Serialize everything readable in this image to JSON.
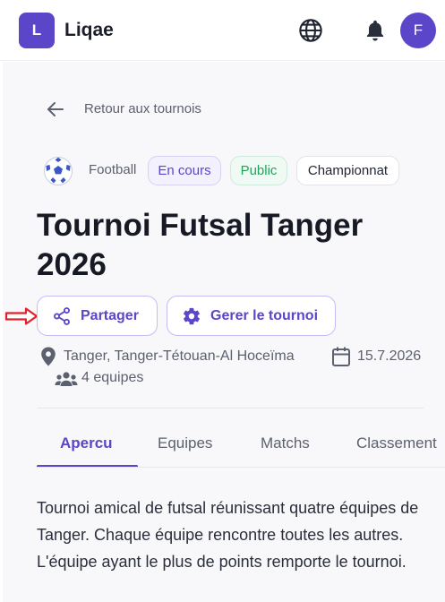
{
  "app": {
    "logo_letter": "L",
    "name": "Liqae",
    "avatar_letter": "F"
  },
  "nav": {
    "back_label": "Retour aux tournois"
  },
  "tournament": {
    "sport": "Football",
    "status": "En cours",
    "visibility": "Public",
    "type": "Championnat",
    "title": "Tournoi Futsal Tanger 2026",
    "location": "Tanger, Tanger-Tétouan-Al Hoceïma",
    "date": "15.7.2026",
    "teams": "4 equipes",
    "description": "Tournoi amical de futsal réunissant quatre équipes de Tanger. Chaque équipe rencontre toutes les autres. L'équipe ayant le plus de points remporte le tournoi."
  },
  "actions": {
    "share_label": "Partager",
    "manage_label": "Gerer le tournoi"
  },
  "tabs": [
    {
      "label": "Apercu",
      "active": true
    },
    {
      "label": "Equipes",
      "active": false
    },
    {
      "label": "Matchs",
      "active": false
    },
    {
      "label": "Classement",
      "active": false
    }
  ],
  "icons": {
    "logo": "logo-icon",
    "globe": "globe-icon",
    "bell": "bell-icon",
    "back": "arrow-left-icon",
    "sport": "soccer-ball-icon",
    "share": "share-icon",
    "manage": "gear-icon",
    "location": "map-pin-icon",
    "date": "calendar-icon",
    "teams": "users-icon",
    "annotation": "red-arrow-icon"
  },
  "colors": {
    "accent": "#5b45c9",
    "public_green": "#22a35a",
    "annotation_red": "#e0202a",
    "text_muted": "#5c6170"
  }
}
